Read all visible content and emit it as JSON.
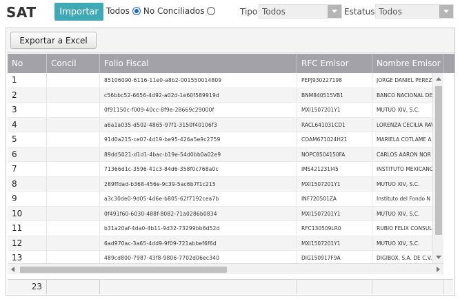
{
  "app": {
    "title": "SAT"
  },
  "toolbar": {
    "import_label": "Importar",
    "radio_all": "Todos",
    "radio_unreconciled": "No Conciliados",
    "tipo_label": "Tipo",
    "tipo_value": "Todos",
    "estatus_label": "Estatus",
    "estatus_value": "Todos"
  },
  "grid": {
    "export_label": "Exportar a Excel",
    "columns": [
      "No",
      "Concil",
      "Folio Fiscal",
      "RFC Emisor",
      "Nombre Emisor"
    ],
    "rows": [
      {
        "no": "1",
        "concil": "",
        "folio": "85106090-6116-11e0-a8b2-001550014809",
        "rfc": "PEPJ930227198",
        "nombre": "JORGE DANIEL PEREZ"
      },
      {
        "no": "2",
        "concil": "",
        "folio": "c56bbc52-6656-4d92-a02d-1e60f589919d",
        "rfc": "BNM840515VB1",
        "nombre": "BANCO NACIONAL DE"
      },
      {
        "no": "3",
        "concil": "",
        "folio": "0f91150c-f009-40cc-8f9e-28669c29000f",
        "rfc": "MXI1507201Y1",
        "nombre": "MUTUO XIV, S.C."
      },
      {
        "no": "4",
        "concil": "",
        "folio": "a6a1a035-d502-4865-97f1-3150f40106f3",
        "rfc": "RACL641031CD1",
        "nombre": "LORENZA CECILIA RAV"
      },
      {
        "no": "5",
        "concil": "",
        "folio": "91d0a215-ce07-4d19-be95-426a5e9c2759",
        "rfc": "COAM671024H21",
        "nombre": "MARIELA COTLAME A"
      },
      {
        "no": "6",
        "concil": "",
        "folio": "89dd5021-d1d1-4bac-b19e-54d0bb0a02e9",
        "rfc": "NOPC8504150FA",
        "nombre": "CARLOS AARON NOR"
      },
      {
        "no": "7",
        "concil": "",
        "folio": "71366d1c-3596-41c3-84d6-358f0c768a0c",
        "rfc": "IMS421231I45",
        "nombre": "INSTITUTO MEXICANO"
      },
      {
        "no": "8",
        "concil": "",
        "folio": "289ffdad-b368-456e-9c39-5ac6b7f1c215",
        "rfc": "MXI1507201Y1",
        "nombre": "MUTUO XIV, S.C."
      },
      {
        "no": "9",
        "concil": "",
        "folio": "a3c30de0-9d05-4d6e-b805-62f7192cea7b",
        "rfc": "INF720501ZA",
        "nombre": "Instituto del Fondo N"
      },
      {
        "no": "10",
        "concil": "",
        "folio": "0f491f60-6030-488f-8082-71a0286b0834",
        "rfc": "MXI1507201Y1",
        "nombre": "MUTUO XIV, S.C."
      },
      {
        "no": "11",
        "concil": "",
        "folio": "b31a20af-4da0-4b11-9d32-73299bb6d52d",
        "rfc": "RFC130509LR0",
        "nombre": "RUBIO FELIX CONSUL"
      },
      {
        "no": "12",
        "concil": "",
        "folio": "6ad970ac-3a65-4dd9-9f09-721abbef6f6d",
        "rfc": "MXI1507201Y1",
        "nombre": "MUTUO XIV, S.C."
      },
      {
        "no": "13",
        "concil": "",
        "folio": "489cd800-7987-43f8-9806-7702d06ec340",
        "rfc": "DIG150917F9A",
        "nombre": "DIGIBOX, S.A. DE C.V."
      }
    ],
    "footer_count": "23"
  }
}
